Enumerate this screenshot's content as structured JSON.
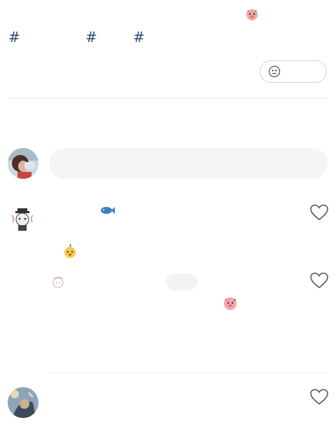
{
  "post": {
    "hashtags": [
      "#",
      "#",
      "#"
    ]
  },
  "comment_composer": {
    "placeholder": ""
  },
  "comments": [
    {
      "like_icon": "heart-outline-icon"
    },
    {
      "like_icon": "heart-outline-icon"
    },
    {
      "like_icon": "heart-outline-icon"
    }
  ],
  "colors": {
    "hashtag": "#2b4a7a",
    "input_bg": "#f4f4f4",
    "divider": "#ececec"
  }
}
